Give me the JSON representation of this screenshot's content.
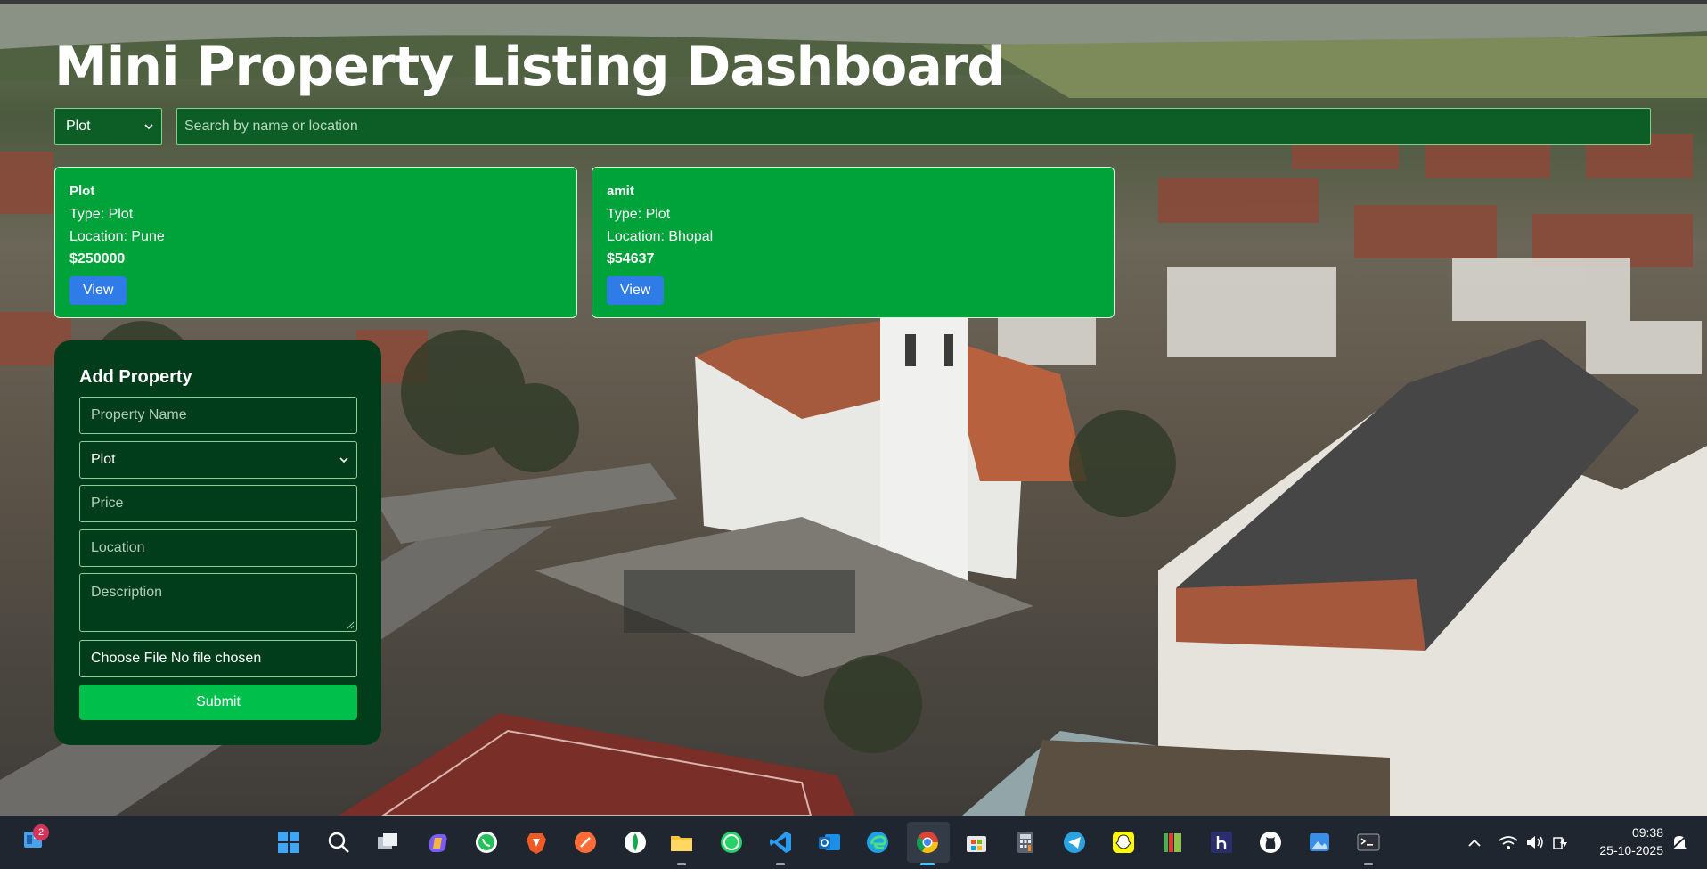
{
  "app": {
    "title": "Mini Property Listing Dashboard"
  },
  "filters": {
    "type_selected": "Plot",
    "search_placeholder": "Search by name or location"
  },
  "listings": [
    {
      "name": "Plot",
      "type": "Type: Plot",
      "location": "Location: Pune",
      "price": "$250000",
      "view_label": "View"
    },
    {
      "name": "amit",
      "type": "Type: Plot",
      "location": "Location: Bhopal",
      "price": "$54637",
      "view_label": "View"
    }
  ],
  "form": {
    "title": "Add Property",
    "name_placeholder": "Property Name",
    "type_selected": "Plot",
    "price_placeholder": "Price",
    "location_placeholder": "Location",
    "description_placeholder": "Description",
    "file_label": "Choose File No file chosen",
    "submit_label": "Submit"
  },
  "taskbar": {
    "badge_count": "2",
    "time": "09:38",
    "date": "25-10-2025",
    "icons": [
      "widgets-icon",
      "windows-start-icon",
      "search-icon",
      "task-view-icon",
      "copilot-icon",
      "whatsapp-icon",
      "brave-icon",
      "postman-icon",
      "mongodb-icon",
      "file-explorer-icon",
      "whatsapp-desktop-icon",
      "vscode-icon",
      "outlook-icon",
      "edge-icon",
      "chrome-icon",
      "microsoft-store-icon",
      "calculator-icon",
      "telegram-icon",
      "snapchat-icon",
      "library-icon",
      "hashnode-icon",
      "github-icon",
      "photos-icon",
      "terminal-icon"
    ]
  },
  "colors": {
    "card_bg": "#00a33a",
    "panel_bg": "#013d1b",
    "view_button": "#2f7be8",
    "submit_button": "#00c04b",
    "input_bg": "#0d5e26"
  }
}
